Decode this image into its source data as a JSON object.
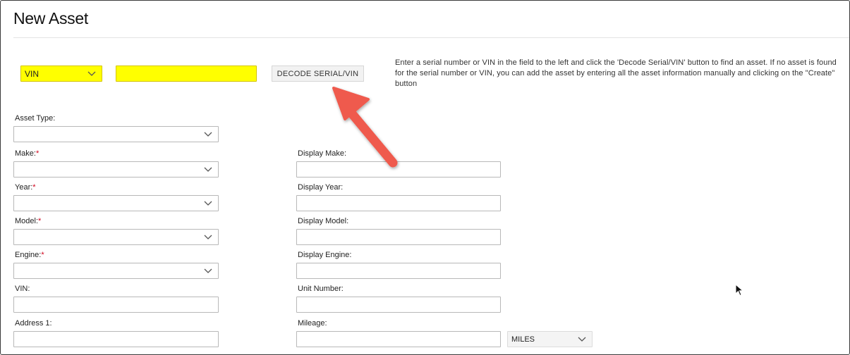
{
  "page": {
    "title": "New Asset"
  },
  "lookup": {
    "type_select_value": "VIN",
    "serial_input_value": "",
    "decode_button_label": "DECODE SERIAL/VIN",
    "help_text": "Enter a serial number or VIN in the field to the left and click the 'Decode Serial/VIN' button to find an asset. If no asset is found for the serial number or VIN, you can add the asset by entering all the asset information manually and clicking on the \"Create\" button",
    "highlight_color": "#ffff00"
  },
  "form": {
    "asset_type": {
      "label": "Asset Type:",
      "value": ""
    },
    "make": {
      "label": "Make:",
      "required_mark": "*",
      "value": ""
    },
    "year": {
      "label": "Year:",
      "required_mark": "*",
      "value": ""
    },
    "model": {
      "label": "Model:",
      "required_mark": "*",
      "value": ""
    },
    "engine": {
      "label": "Engine:",
      "required_mark": "*",
      "value": ""
    },
    "vin": {
      "label": "VIN:",
      "value": ""
    },
    "address1": {
      "label": "Address 1:",
      "value": ""
    },
    "display_make": {
      "label": "Display Make:",
      "value": ""
    },
    "display_year": {
      "label": "Display Year:",
      "value": ""
    },
    "display_model": {
      "label": "Display Model:",
      "value": ""
    },
    "display_engine": {
      "label": "Display Engine:",
      "value": ""
    },
    "unit_number": {
      "label": "Unit Number:",
      "value": ""
    },
    "mileage": {
      "label": "Mileage:",
      "value": "",
      "units_value": "MILES"
    }
  },
  "colors": {
    "required": "#d0021b",
    "annotation_arrow": "#ef5a4e"
  },
  "icons": {
    "dropdown": "chevron-down-icon",
    "annotation": "annotation-arrow-icon",
    "pointer": "mouse-cursor-icon"
  }
}
